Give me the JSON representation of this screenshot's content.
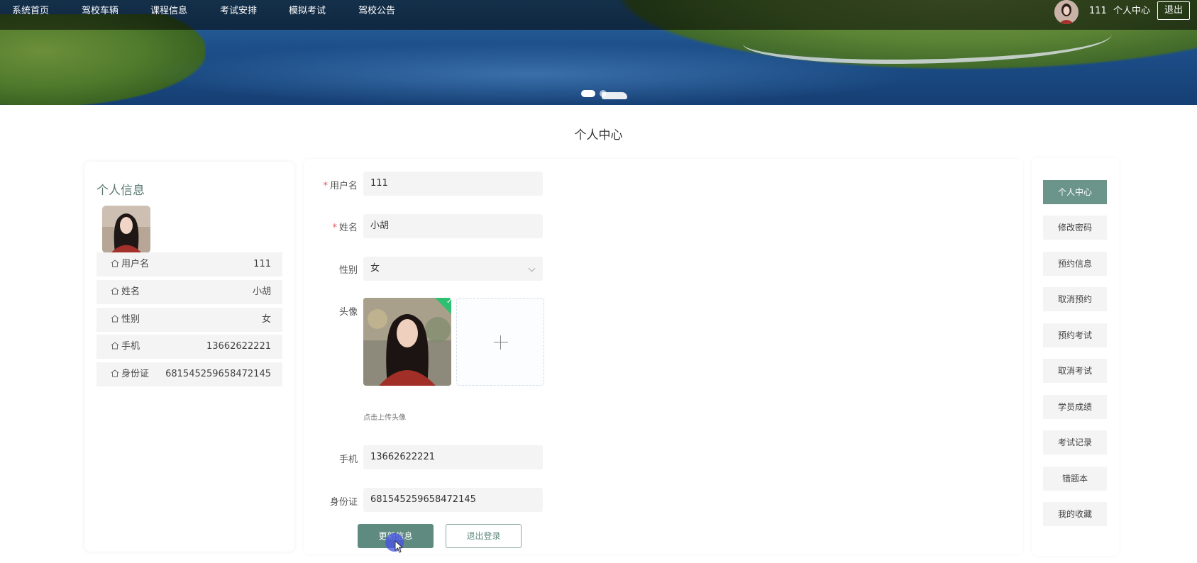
{
  "nav": {
    "items": [
      "系统首页",
      "驾校车辆",
      "课程信息",
      "考试安排",
      "模拟考试",
      "驾校公告"
    ],
    "username": "111",
    "center_link": "个人中心",
    "logout": "退出"
  },
  "page_title": "个人中心",
  "profile_card": {
    "title": "个人信息",
    "rows": [
      {
        "label": "用户名",
        "value": "111"
      },
      {
        "label": "姓名",
        "value": "小胡"
      },
      {
        "label": "性别",
        "value": "女"
      },
      {
        "label": "手机",
        "value": "13662622221"
      },
      {
        "label": "身份证",
        "value": "681545259658472145"
      }
    ]
  },
  "form": {
    "username_label": "用户名",
    "username_value": "111",
    "name_label": "姓名",
    "name_value": "小胡",
    "gender_label": "性别",
    "gender_value": "女",
    "avatar_label": "头像",
    "upload_hint": "点击上传头像",
    "phone_label": "手机",
    "phone_value": "13662622221",
    "idcard_label": "身份证",
    "idcard_value": "681545259658472145",
    "update_button": "更新信息",
    "logout_button": "退出登录"
  },
  "side_menu": {
    "items": [
      "个人中心",
      "修改密码",
      "预约信息",
      "取消预约",
      "预约考试",
      "取消考试",
      "学员成绩",
      "考试记录",
      "错题本",
      "我的收藏"
    ],
    "active_index": 0
  },
  "colors": {
    "accent": "#6b958b",
    "required": "#e05b5b",
    "success": "#2fbf71"
  }
}
